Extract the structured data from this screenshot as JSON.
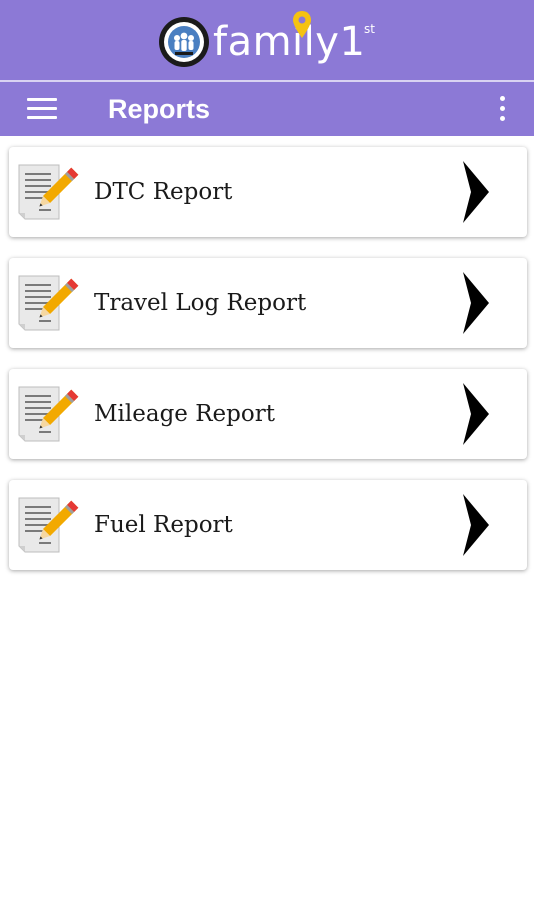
{
  "brand": {
    "name": "family1",
    "superscript": "st",
    "badge_icon": "family-badge-icon",
    "pin_icon": "location-pin-icon"
  },
  "toolbar": {
    "title": "Reports",
    "menu_icon": "hamburger-menu-icon",
    "overflow_icon": "more-vert-icon"
  },
  "reports": [
    {
      "label": "DTC Report",
      "icon": "document-pencil-icon"
    },
    {
      "label": "Travel Log Report",
      "icon": "document-pencil-icon"
    },
    {
      "label": "Mileage Report",
      "icon": "document-pencil-icon"
    },
    {
      "label": "Fuel Report",
      "icon": "document-pencil-icon"
    }
  ],
  "colors": {
    "app_bar": "#8c79d6",
    "pin": "#f5c211",
    "pencil_red": "#e53935",
    "pencil_body": "#f2a900"
  }
}
